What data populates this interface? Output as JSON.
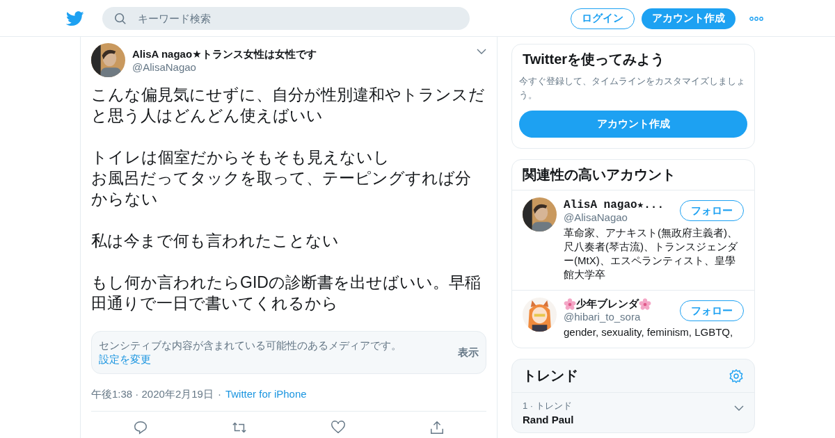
{
  "header": {
    "search": {
      "placeholder": "キーワード検索"
    },
    "login": "ログイン",
    "signup": "アカウント作成"
  },
  "tweet": {
    "name": "AlisA nagao★トランス女性は女性です",
    "handle": "@AlisaNagao",
    "paragraphs": [
      [
        "こんな偏見気にせずに、自分が性別違和やトランスだと思う人はどんどん使えばいい"
      ],
      [
        "トイレは個室だからそもそも見えないし",
        "お風呂だってタックを取って、テーピングすれば分からない"
      ],
      [
        "私は今まで何も言われたことない"
      ],
      [
        "もし何か言われたらGIDの診断書を出せばいい。早稲田通りで一日で書いてくれるから"
      ]
    ],
    "sensitive": {
      "notice": "センシティブな内容が含まれている可能性のあるメディアです。",
      "settings_link": "設定を変更",
      "show": "表示"
    },
    "time": "午後1:38 · 2020年2月19日",
    "separator": "·",
    "source": "Twitter for iPhone"
  },
  "signup_card": {
    "title": "Twitterを使ってみよう",
    "text": "今すぐ登録して、タイムラインをカスタマイズしましょう。",
    "button": "アカウント作成"
  },
  "related": {
    "title": "関連性の高いアカウント",
    "accounts": [
      {
        "name": "AlisA nagao★...",
        "handle": "@AlisaNagao",
        "bio": "革命家、アナキスト(無政府主義者)、尺八奏者(琴古流)、トランスジェンダー(MtX)、エスペランティスト、皇學館大学卒",
        "follow": "フォロー",
        "flowers": false
      },
      {
        "name": "少年ブレンダ",
        "handle": "@hibari_to_sora",
        "bio": "gender, sexuality, feminism, LGBTQ,",
        "follow": "フォロー",
        "flowers": true
      }
    ]
  },
  "trends": {
    "title": "トレンド",
    "items": [
      {
        "meta": "1 · トレンド",
        "name": "Rand Paul"
      }
    ]
  }
}
